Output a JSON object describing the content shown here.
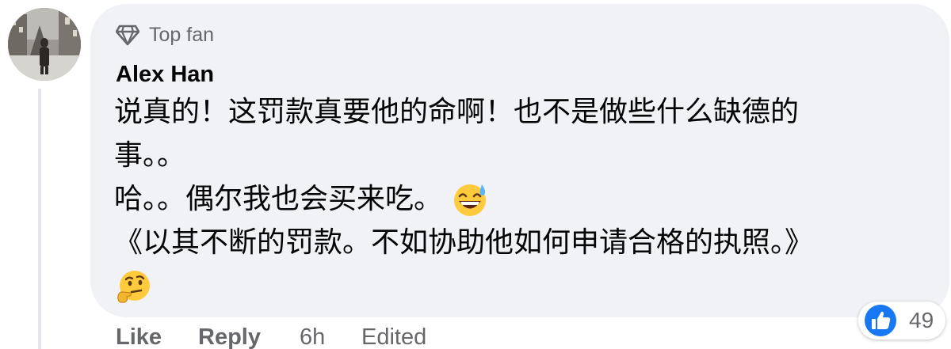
{
  "comment": {
    "badge": {
      "icon": "diamond-icon",
      "label": "Top fan"
    },
    "author": "Alex Han",
    "lines": [
      "说真的！这罚款真要他的命啊！也不是做些什么缺德的",
      "事。。",
      "哈。。偶尔我也会买来吃。",
      "《以其不断的罚款。不如协助他如何申请合格的执照。》",
      ""
    ],
    "emojis": [
      "grinning-face-with-sweat-emoji",
      "thinking-face-emoji"
    ],
    "reactions": {
      "icon": "like-icon",
      "count": "49",
      "accent": "#1877f2"
    },
    "actions": {
      "like": "Like",
      "reply": "Reply",
      "time": "6h",
      "edited": "Edited"
    }
  },
  "colors": {
    "bubble": "#f0f2f5",
    "text": "#050505",
    "secondary": "#65676b"
  }
}
